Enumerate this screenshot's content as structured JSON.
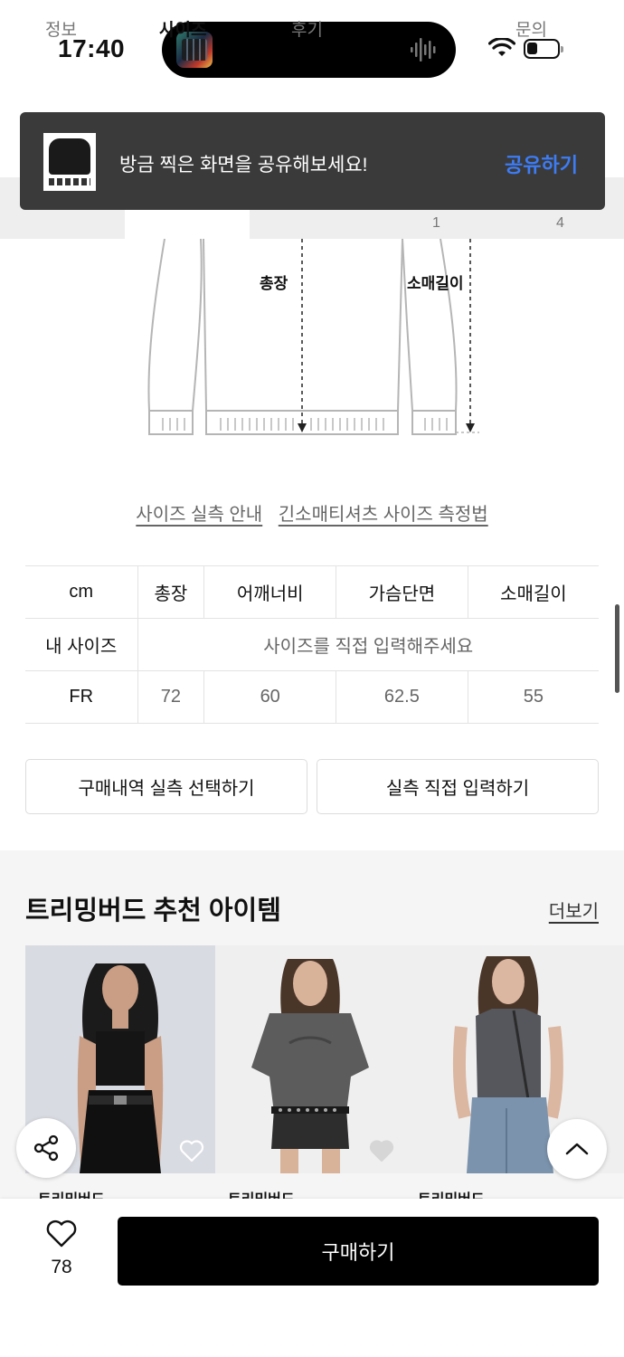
{
  "status_bar": {
    "time": "17:40"
  },
  "tabs": {
    "items": [
      {
        "label": "정보"
      },
      {
        "label": "사이즈"
      },
      {
        "label": "후기",
        "count": "1"
      },
      {
        "label": "문의",
        "count": "4"
      }
    ]
  },
  "toast": {
    "message": "방금 찍은 화면을 공유해보세요!",
    "action": "공유하기"
  },
  "diagram": {
    "length_label": "총장",
    "sleeve_label": "소매길이"
  },
  "guide_links": {
    "size_guide": "사이즈 실측 안내",
    "measure_method": "긴소매티셔츠 사이즈 측정법"
  },
  "size_table": {
    "unit": "cm",
    "columns": [
      "총장",
      "어깨너비",
      "가슴단면",
      "소매길이"
    ],
    "my_size_label": "내 사이즈",
    "my_size_placeholder": "사이즈를 직접 입력해주세요",
    "rows": [
      {
        "size": "FR",
        "values": [
          "72",
          "60",
          "62.5",
          "55"
        ]
      }
    ]
  },
  "buttons": {
    "select_purchase": "구매내역 실측 선택하기",
    "direct_input": "실측 직접 입력하기"
  },
  "recommend": {
    "title": "트리밍버드 추천 아이템",
    "more": "더보기",
    "items": [
      {
        "brand": "트리밍버드"
      },
      {
        "brand": "트리밍버드"
      },
      {
        "brand": "트리밍버드"
      }
    ]
  },
  "bottom_bar": {
    "like_count": "78",
    "buy_label": "구매하기"
  }
}
